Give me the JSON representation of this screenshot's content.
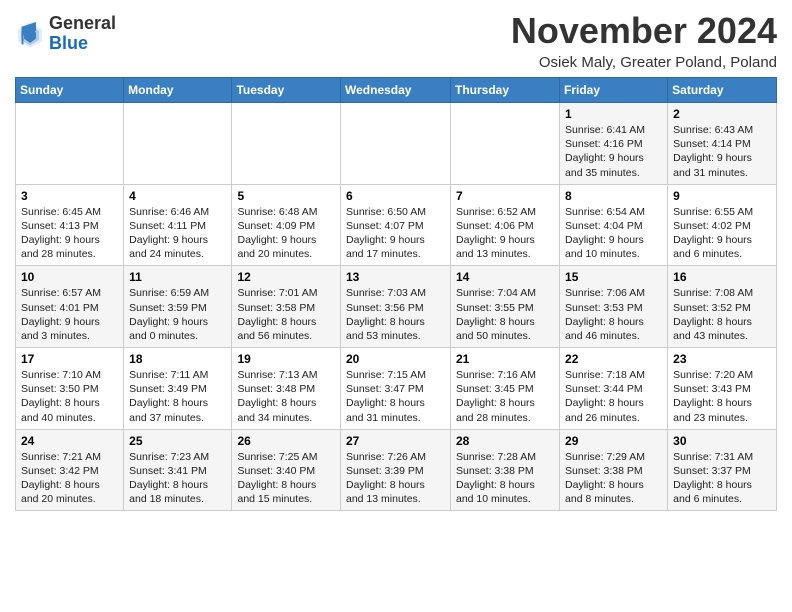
{
  "header": {
    "logo_general": "General",
    "logo_blue": "Blue",
    "month_title": "November 2024",
    "location": "Osiek Maly, Greater Poland, Poland"
  },
  "days_of_week": [
    "Sunday",
    "Monday",
    "Tuesday",
    "Wednesday",
    "Thursday",
    "Friday",
    "Saturday"
  ],
  "weeks": [
    [
      {
        "day": "",
        "info": ""
      },
      {
        "day": "",
        "info": ""
      },
      {
        "day": "",
        "info": ""
      },
      {
        "day": "",
        "info": ""
      },
      {
        "day": "",
        "info": ""
      },
      {
        "day": "1",
        "info": "Sunrise: 6:41 AM\nSunset: 4:16 PM\nDaylight: 9 hours\nand 35 minutes."
      },
      {
        "day": "2",
        "info": "Sunrise: 6:43 AM\nSunset: 4:14 PM\nDaylight: 9 hours\nand 31 minutes."
      }
    ],
    [
      {
        "day": "3",
        "info": "Sunrise: 6:45 AM\nSunset: 4:13 PM\nDaylight: 9 hours\nand 28 minutes."
      },
      {
        "day": "4",
        "info": "Sunrise: 6:46 AM\nSunset: 4:11 PM\nDaylight: 9 hours\nand 24 minutes."
      },
      {
        "day": "5",
        "info": "Sunrise: 6:48 AM\nSunset: 4:09 PM\nDaylight: 9 hours\nand 20 minutes."
      },
      {
        "day": "6",
        "info": "Sunrise: 6:50 AM\nSunset: 4:07 PM\nDaylight: 9 hours\nand 17 minutes."
      },
      {
        "day": "7",
        "info": "Sunrise: 6:52 AM\nSunset: 4:06 PM\nDaylight: 9 hours\nand 13 minutes."
      },
      {
        "day": "8",
        "info": "Sunrise: 6:54 AM\nSunset: 4:04 PM\nDaylight: 9 hours\nand 10 minutes."
      },
      {
        "day": "9",
        "info": "Sunrise: 6:55 AM\nSunset: 4:02 PM\nDaylight: 9 hours\nand 6 minutes."
      }
    ],
    [
      {
        "day": "10",
        "info": "Sunrise: 6:57 AM\nSunset: 4:01 PM\nDaylight: 9 hours\nand 3 minutes."
      },
      {
        "day": "11",
        "info": "Sunrise: 6:59 AM\nSunset: 3:59 PM\nDaylight: 9 hours\nand 0 minutes."
      },
      {
        "day": "12",
        "info": "Sunrise: 7:01 AM\nSunset: 3:58 PM\nDaylight: 8 hours\nand 56 minutes."
      },
      {
        "day": "13",
        "info": "Sunrise: 7:03 AM\nSunset: 3:56 PM\nDaylight: 8 hours\nand 53 minutes."
      },
      {
        "day": "14",
        "info": "Sunrise: 7:04 AM\nSunset: 3:55 PM\nDaylight: 8 hours\nand 50 minutes."
      },
      {
        "day": "15",
        "info": "Sunrise: 7:06 AM\nSunset: 3:53 PM\nDaylight: 8 hours\nand 46 minutes."
      },
      {
        "day": "16",
        "info": "Sunrise: 7:08 AM\nSunset: 3:52 PM\nDaylight: 8 hours\nand 43 minutes."
      }
    ],
    [
      {
        "day": "17",
        "info": "Sunrise: 7:10 AM\nSunset: 3:50 PM\nDaylight: 8 hours\nand 40 minutes."
      },
      {
        "day": "18",
        "info": "Sunrise: 7:11 AM\nSunset: 3:49 PM\nDaylight: 8 hours\nand 37 minutes."
      },
      {
        "day": "19",
        "info": "Sunrise: 7:13 AM\nSunset: 3:48 PM\nDaylight: 8 hours\nand 34 minutes."
      },
      {
        "day": "20",
        "info": "Sunrise: 7:15 AM\nSunset: 3:47 PM\nDaylight: 8 hours\nand 31 minutes."
      },
      {
        "day": "21",
        "info": "Sunrise: 7:16 AM\nSunset: 3:45 PM\nDaylight: 8 hours\nand 28 minutes."
      },
      {
        "day": "22",
        "info": "Sunrise: 7:18 AM\nSunset: 3:44 PM\nDaylight: 8 hours\nand 26 minutes."
      },
      {
        "day": "23",
        "info": "Sunrise: 7:20 AM\nSunset: 3:43 PM\nDaylight: 8 hours\nand 23 minutes."
      }
    ],
    [
      {
        "day": "24",
        "info": "Sunrise: 7:21 AM\nSunset: 3:42 PM\nDaylight: 8 hours\nand 20 minutes."
      },
      {
        "day": "25",
        "info": "Sunrise: 7:23 AM\nSunset: 3:41 PM\nDaylight: 8 hours\nand 18 minutes."
      },
      {
        "day": "26",
        "info": "Sunrise: 7:25 AM\nSunset: 3:40 PM\nDaylight: 8 hours\nand 15 minutes."
      },
      {
        "day": "27",
        "info": "Sunrise: 7:26 AM\nSunset: 3:39 PM\nDaylight: 8 hours\nand 13 minutes."
      },
      {
        "day": "28",
        "info": "Sunrise: 7:28 AM\nSunset: 3:38 PM\nDaylight: 8 hours\nand 10 minutes."
      },
      {
        "day": "29",
        "info": "Sunrise: 7:29 AM\nSunset: 3:38 PM\nDaylight: 8 hours\nand 8 minutes."
      },
      {
        "day": "30",
        "info": "Sunrise: 7:31 AM\nSunset: 3:37 PM\nDaylight: 8 hours\nand 6 minutes."
      }
    ]
  ]
}
